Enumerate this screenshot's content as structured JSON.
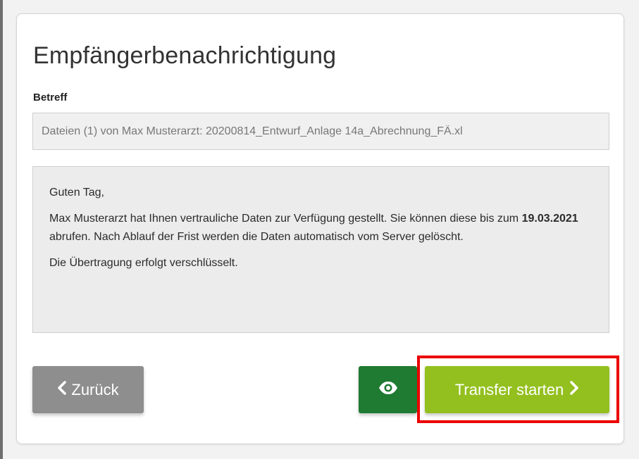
{
  "dialog": {
    "title": "Empfängerbenachrichtigung",
    "subject_label": "Betreff",
    "subject_value": "Dateien (1) von Max Musterarzt: 20200814_Entwurf_Anlage 14a_Abrechnung_FÄ.xl"
  },
  "message": {
    "greeting": "Guten Tag,",
    "body_part1": "Max Musterarzt hat Ihnen vertrauliche Daten zur Verfügung gestellt. Sie können diese bis zum",
    "deadline": "19.03.2021",
    "body_part2": "abrufen. Nach Ablauf der Frist werden die Daten automatisch vom Server gelöscht.",
    "encryption_note": "Die Übertragung erfolgt verschlüsselt."
  },
  "buttons": {
    "back_label": "Zurück",
    "preview_icon": "eye-icon",
    "start_label": "Transfer starten"
  },
  "colors": {
    "back_button": "#8e8e8e",
    "preview_button": "#1f7a32",
    "start_button": "#93c01f",
    "highlight_border": "#ec0000"
  }
}
